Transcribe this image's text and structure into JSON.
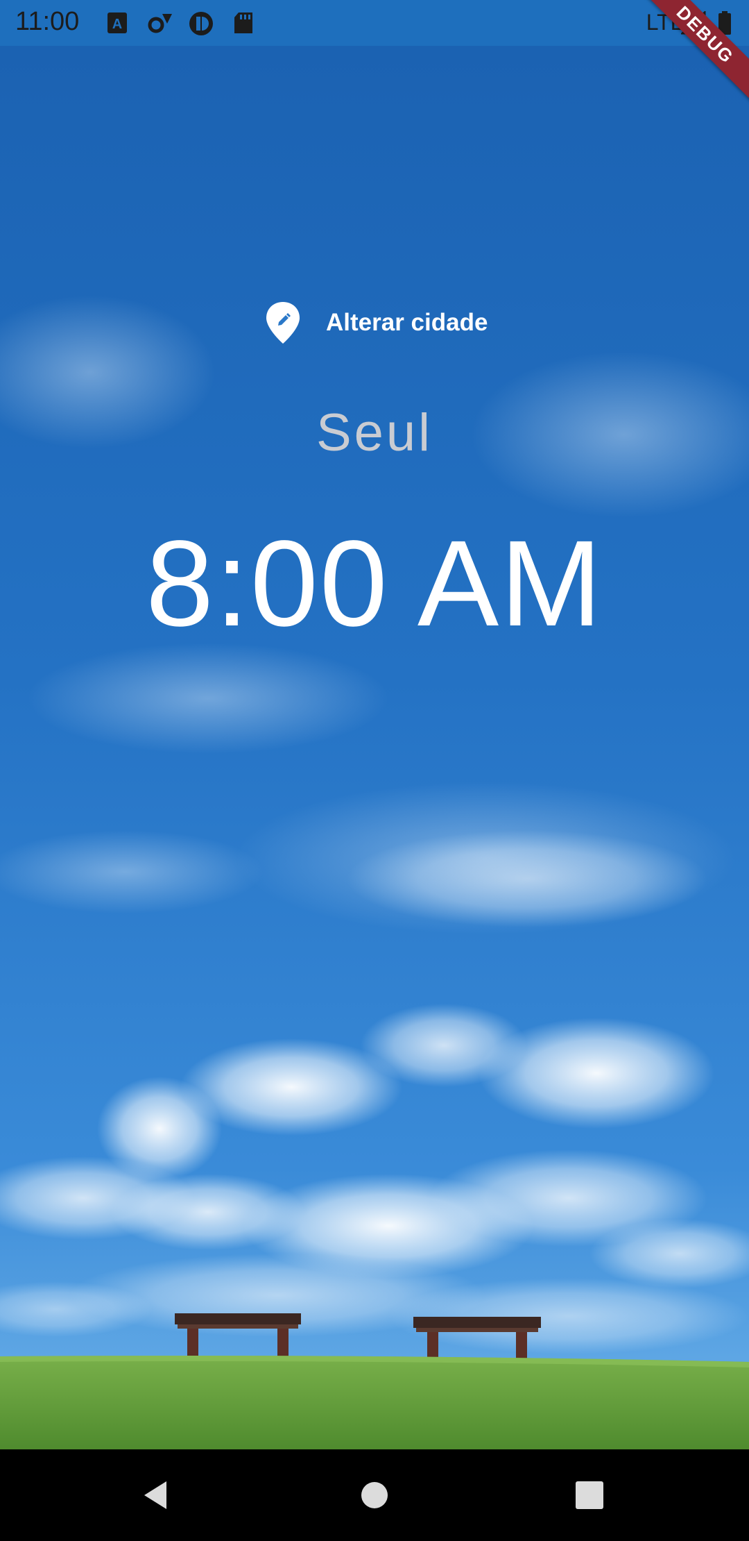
{
  "status_bar": {
    "time": "11:00",
    "network_label": "LTE",
    "icons": [
      "text-a-icon",
      "settings-gear-icon",
      "app-circle-icon",
      "sd-card-icon",
      "signal-icon",
      "battery-icon"
    ]
  },
  "debug_banner": "DEBUG",
  "main": {
    "change_city_label": "Alterar cidade",
    "change_city_icon": "edit-location-icon",
    "city": "Seul",
    "time": "8:00 AM"
  },
  "background": {
    "sky_top": "#1c64b4",
    "sky_bottom": "#4d9ae0",
    "grass": "#6aa53f"
  },
  "nav_bar": {
    "buttons": [
      "back-icon",
      "home-icon",
      "recents-icon"
    ]
  }
}
